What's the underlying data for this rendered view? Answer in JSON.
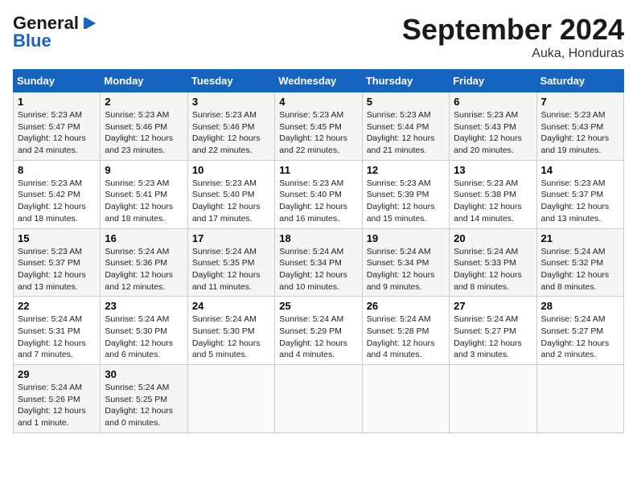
{
  "header": {
    "logo_general": "General",
    "logo_blue": "Blue",
    "month_title": "September 2024",
    "location": "Auka, Honduras"
  },
  "weekdays": [
    "Sunday",
    "Monday",
    "Tuesday",
    "Wednesday",
    "Thursday",
    "Friday",
    "Saturday"
  ],
  "weeks": [
    [
      {
        "day": "1",
        "sunrise": "5:23 AM",
        "sunset": "5:47 PM",
        "daylight": "12 hours and 24 minutes."
      },
      {
        "day": "2",
        "sunrise": "5:23 AM",
        "sunset": "5:46 PM",
        "daylight": "12 hours and 23 minutes."
      },
      {
        "day": "3",
        "sunrise": "5:23 AM",
        "sunset": "5:46 PM",
        "daylight": "12 hours and 22 minutes."
      },
      {
        "day": "4",
        "sunrise": "5:23 AM",
        "sunset": "5:45 PM",
        "daylight": "12 hours and 22 minutes."
      },
      {
        "day": "5",
        "sunrise": "5:23 AM",
        "sunset": "5:44 PM",
        "daylight": "12 hours and 21 minutes."
      },
      {
        "day": "6",
        "sunrise": "5:23 AM",
        "sunset": "5:43 PM",
        "daylight": "12 hours and 20 minutes."
      },
      {
        "day": "7",
        "sunrise": "5:23 AM",
        "sunset": "5:43 PM",
        "daylight": "12 hours and 19 minutes."
      }
    ],
    [
      {
        "day": "8",
        "sunrise": "5:23 AM",
        "sunset": "5:42 PM",
        "daylight": "12 hours and 18 minutes."
      },
      {
        "day": "9",
        "sunrise": "5:23 AM",
        "sunset": "5:41 PM",
        "daylight": "12 hours and 18 minutes."
      },
      {
        "day": "10",
        "sunrise": "5:23 AM",
        "sunset": "5:40 PM",
        "daylight": "12 hours and 17 minutes."
      },
      {
        "day": "11",
        "sunrise": "5:23 AM",
        "sunset": "5:40 PM",
        "daylight": "12 hours and 16 minutes."
      },
      {
        "day": "12",
        "sunrise": "5:23 AM",
        "sunset": "5:39 PM",
        "daylight": "12 hours and 15 minutes."
      },
      {
        "day": "13",
        "sunrise": "5:23 AM",
        "sunset": "5:38 PM",
        "daylight": "12 hours and 14 minutes."
      },
      {
        "day": "14",
        "sunrise": "5:23 AM",
        "sunset": "5:37 PM",
        "daylight": "12 hours and 13 minutes."
      }
    ],
    [
      {
        "day": "15",
        "sunrise": "5:23 AM",
        "sunset": "5:37 PM",
        "daylight": "12 hours and 13 minutes."
      },
      {
        "day": "16",
        "sunrise": "5:24 AM",
        "sunset": "5:36 PM",
        "daylight": "12 hours and 12 minutes."
      },
      {
        "day": "17",
        "sunrise": "5:24 AM",
        "sunset": "5:35 PM",
        "daylight": "12 hours and 11 minutes."
      },
      {
        "day": "18",
        "sunrise": "5:24 AM",
        "sunset": "5:34 PM",
        "daylight": "12 hours and 10 minutes."
      },
      {
        "day": "19",
        "sunrise": "5:24 AM",
        "sunset": "5:34 PM",
        "daylight": "12 hours and 9 minutes."
      },
      {
        "day": "20",
        "sunrise": "5:24 AM",
        "sunset": "5:33 PM",
        "daylight": "12 hours and 8 minutes."
      },
      {
        "day": "21",
        "sunrise": "5:24 AM",
        "sunset": "5:32 PM",
        "daylight": "12 hours and 8 minutes."
      }
    ],
    [
      {
        "day": "22",
        "sunrise": "5:24 AM",
        "sunset": "5:31 PM",
        "daylight": "12 hours and 7 minutes."
      },
      {
        "day": "23",
        "sunrise": "5:24 AM",
        "sunset": "5:30 PM",
        "daylight": "12 hours and 6 minutes."
      },
      {
        "day": "24",
        "sunrise": "5:24 AM",
        "sunset": "5:30 PM",
        "daylight": "12 hours and 5 minutes."
      },
      {
        "day": "25",
        "sunrise": "5:24 AM",
        "sunset": "5:29 PM",
        "daylight": "12 hours and 4 minutes."
      },
      {
        "day": "26",
        "sunrise": "5:24 AM",
        "sunset": "5:28 PM",
        "daylight": "12 hours and 4 minutes."
      },
      {
        "day": "27",
        "sunrise": "5:24 AM",
        "sunset": "5:27 PM",
        "daylight": "12 hours and 3 minutes."
      },
      {
        "day": "28",
        "sunrise": "5:24 AM",
        "sunset": "5:27 PM",
        "daylight": "12 hours and 2 minutes."
      }
    ],
    [
      {
        "day": "29",
        "sunrise": "5:24 AM",
        "sunset": "5:26 PM",
        "daylight": "12 hours and 1 minute."
      },
      {
        "day": "30",
        "sunrise": "5:24 AM",
        "sunset": "5:25 PM",
        "daylight": "12 hours and 0 minutes."
      },
      null,
      null,
      null,
      null,
      null
    ]
  ],
  "labels": {
    "sunrise": "Sunrise:",
    "sunset": "Sunset:",
    "daylight": "Daylight:"
  }
}
